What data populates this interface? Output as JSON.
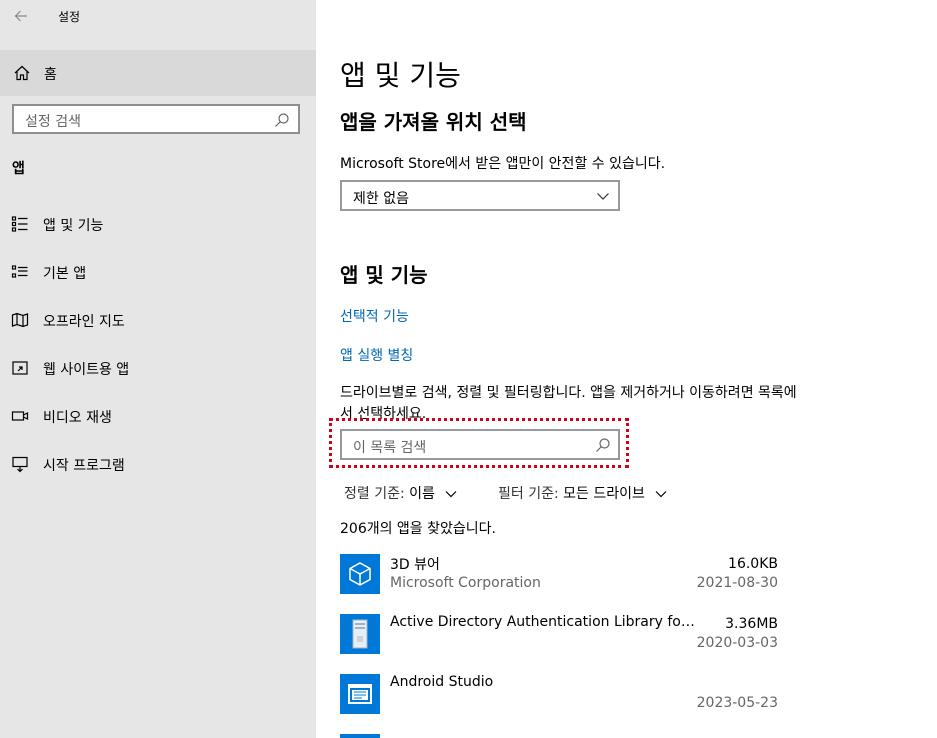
{
  "window": {
    "title": "설정"
  },
  "sidebar": {
    "home_label": "홈",
    "search_placeholder": "설정 검색",
    "section": "앱",
    "items": [
      {
        "label": "앱 및 기능",
        "icon": "apps-list-icon"
      },
      {
        "label": "기본 앱",
        "icon": "default-apps-icon"
      },
      {
        "label": "오프라인 지도",
        "icon": "map-icon"
      },
      {
        "label": "웹 사이트용 앱",
        "icon": "web-apps-icon"
      },
      {
        "label": "비디오 재생",
        "icon": "video-icon"
      },
      {
        "label": "시작 프로그램",
        "icon": "startup-icon"
      }
    ]
  },
  "main": {
    "page_title": "앱 및 기능",
    "install_section": {
      "title": "앱을 가져올 위치 선택",
      "description": "Microsoft Store에서 받은 앱만이 안전할 수 있습니다.",
      "dropdown_value": "제한 없음"
    },
    "apps_section": {
      "title": "앱 및 기능",
      "link_optional": "선택적 기능",
      "link_alias": "앱 실행 별칭",
      "description": "드라이브별로 검색, 정렬 및 필터링합니다. 앱을 제거하거나 이동하려면 목록에서 선택하세요.",
      "search_placeholder": "이 목록 검색",
      "sort_label": "정렬 기준:",
      "sort_value": "이름",
      "filter_label": "필터 기준:",
      "filter_value": "모든 드라이브",
      "count_text": "206개의 앱을 찾았습니다."
    },
    "apps": [
      {
        "name": "3D 뷰어",
        "publisher": "Microsoft Corporation",
        "size": "16.0KB",
        "date": "2021-08-30",
        "icon": "cube-icon"
      },
      {
        "name": "Active Directory Authentication Library for SQL Server",
        "publisher": "",
        "size": "3.36MB",
        "date": "2020-03-03",
        "icon": "installer-icon"
      },
      {
        "name": "Android Studio",
        "publisher": "",
        "size": "",
        "date": "2023-05-23",
        "icon": "window-app-icon"
      }
    ]
  },
  "colors": {
    "sidebar_bg": "#e6e6e6",
    "accent": "#0078d7",
    "link": "#0067b8",
    "highlight": "#d0021b"
  }
}
